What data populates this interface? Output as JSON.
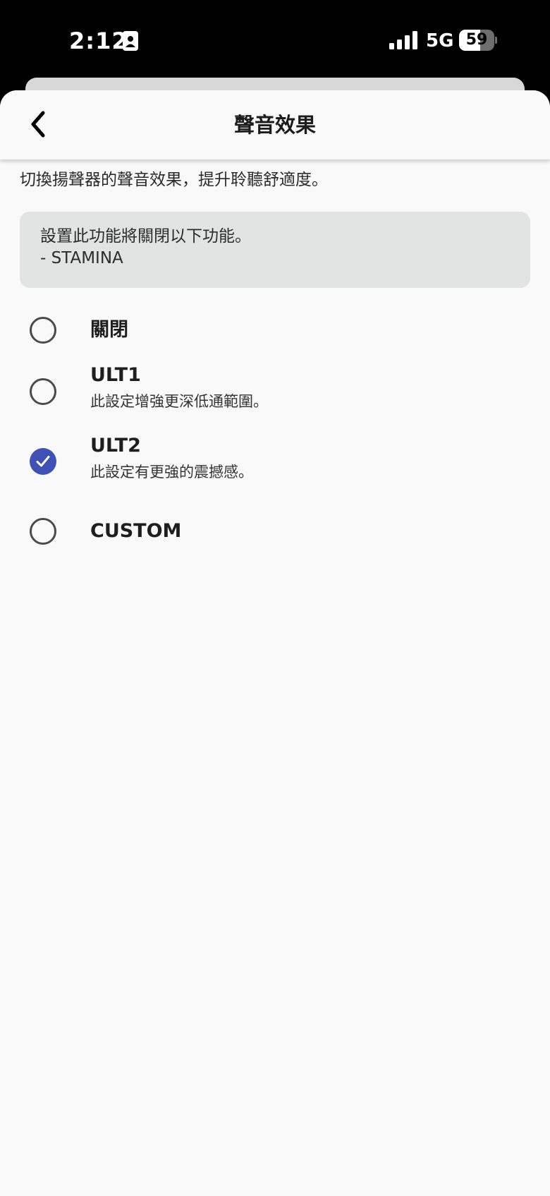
{
  "status_bar": {
    "time": "2:12",
    "network": "5G",
    "battery_level": "59",
    "battery_fraction": 0.59
  },
  "header": {
    "title": "聲音效果",
    "back_icon": "chevron-left-icon"
  },
  "description": "切換揚聲器的聲音效果，提升聆聽舒適度。",
  "notice": {
    "line1": "設置此功能將關閉以下功能。",
    "line2": "- STAMINA"
  },
  "options": [
    {
      "label": "關閉",
      "sub": "",
      "selected": false
    },
    {
      "label": "ULT1",
      "sub": "此設定增強更深低通範圍。",
      "selected": false
    },
    {
      "label": "ULT2",
      "sub": "此設定有更強的震撼感。",
      "selected": true
    },
    {
      "label": "CUSTOM",
      "sub": "",
      "selected": false
    }
  ],
  "colors": {
    "accent": "#3f51b5",
    "background": "#f9f9f9",
    "notice_bg": "#e2e3e3",
    "status_bar_bg": "#000000"
  }
}
